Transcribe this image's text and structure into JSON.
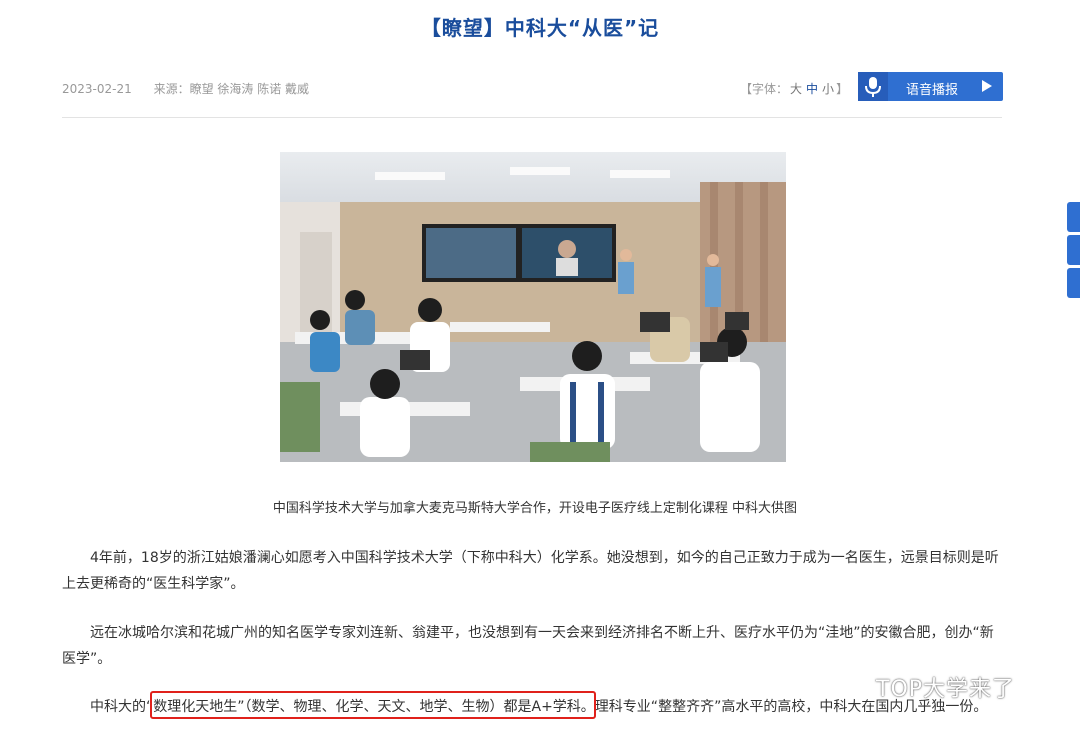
{
  "article": {
    "title": "【瞭望】中科大“从医”记",
    "date": "2023-02-21",
    "source": "来源：瞭望 徐海涛 陈诺 戴威"
  },
  "font_size": {
    "prefix": "【字体：",
    "large": "大",
    "medium": "中",
    "small": "小",
    "suffix": "】",
    "active": "中"
  },
  "voice": {
    "label": "语音播报"
  },
  "image": {
    "caption": "中国科学技术大学与加拿大麦克马斯特大学合作，开设电子医疗线上定制化课程 中科大供图"
  },
  "paragraphs": [
    "4年前，18岁的浙江姑娘潘澜心如愿考入中国科学技术大学（下称中科大）化学系。她没想到，如今的自己正致力于成为一名医生，远景目标则是听上去更稀奇的“医生科学家”。",
    "远在冰城哈尔滨和花城广州的知名医学专家刘连新、翁建平，也没想到有一天会来到经济排名不断上升、医疗水平仍为“洼地”的安徽合肥，创办“新医学”。",
    "中科大的“数理化天地生”（数学、物理、化学、天文、地学、生物）都是A+学科。理科专业“整整齐齐”高水平的高校，中科大在国内几乎独一份。"
  ],
  "watermark": "TOP大学来了",
  "colors": {
    "title": "#1a4d9c",
    "accent": "#2f6fd1",
    "highlight_border": "#e0211b"
  }
}
